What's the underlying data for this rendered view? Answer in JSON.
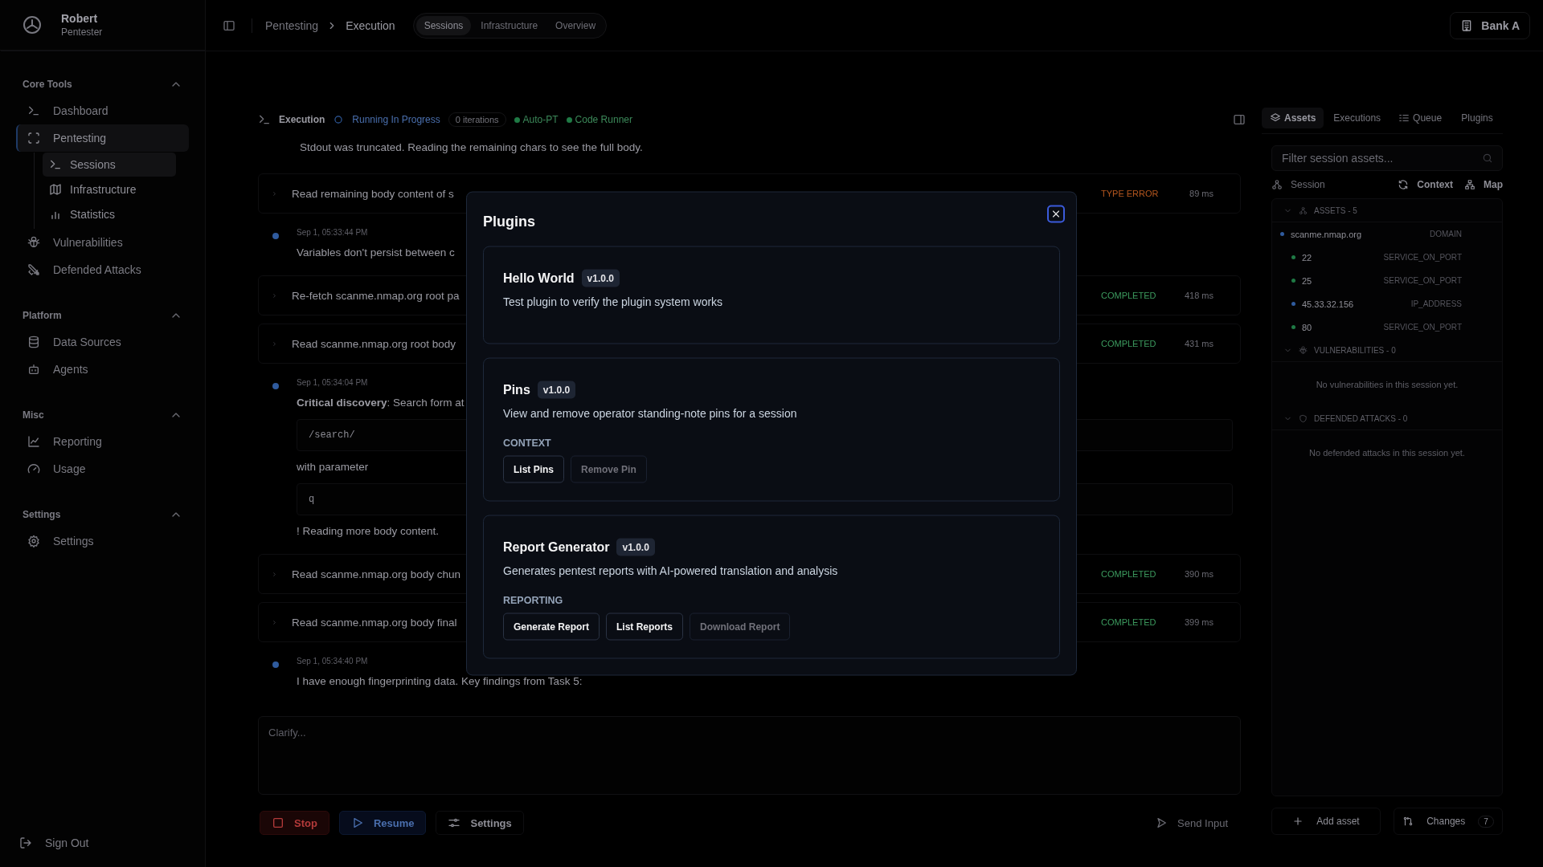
{
  "user": {
    "name": "Robert",
    "role": "Pentester"
  },
  "sidebar": {
    "sections": [
      {
        "title": "Core Tools",
        "expanded": true,
        "items": [
          {
            "label": "Dashboard",
            "selected": false
          },
          {
            "label": "Pentesting",
            "selected": true,
            "children": [
              {
                "label": "Sessions",
                "selected": true
              },
              {
                "label": "Infrastructure",
                "selected": false
              },
              {
                "label": "Statistics",
                "selected": false
              }
            ]
          },
          {
            "label": "Vulnerabilities",
            "selected": false
          },
          {
            "label": "Defended Attacks",
            "selected": false
          }
        ]
      },
      {
        "title": "Platform",
        "expanded": true,
        "items": [
          {
            "label": "Data Sources",
            "selected": false
          },
          {
            "label": "Agents",
            "selected": false
          }
        ]
      },
      {
        "title": "Misc",
        "expanded": true,
        "items": [
          {
            "label": "Reporting",
            "selected": false
          },
          {
            "label": "Usage",
            "selected": false
          }
        ]
      },
      {
        "title": "Settings",
        "expanded": true,
        "items": [
          {
            "label": "Settings",
            "selected": false
          }
        ]
      }
    ],
    "sign_out": "Sign Out"
  },
  "breadcrumb": [
    "Pentesting",
    "Execution"
  ],
  "view_tabs": [
    {
      "label": "Sessions",
      "selected": true
    },
    {
      "label": "Infrastructure",
      "selected": false
    },
    {
      "label": "Overview",
      "selected": false
    }
  ],
  "org_button": "Bank A",
  "execution": {
    "title": "Execution",
    "status": "Running In Progress",
    "iterations": "0 iterations",
    "badges": [
      "Auto-PT",
      "Code Runner"
    ],
    "log": [
      {
        "kind": "text",
        "text": "Stdout was truncated. Reading the remaining chars to see the full body."
      },
      {
        "kind": "tool",
        "text": "Read remaining body content of s",
        "status": {
          "text": "TYPE ERROR",
          "kind": "error"
        },
        "duration": "89 ms"
      },
      {
        "kind": "message",
        "time": "Sep 1, 05:33:44 PM",
        "parts": [
          {
            "kind": "text",
            "text": "Variables don't persist between c"
          }
        ]
      },
      {
        "kind": "tool",
        "text": "Re-fetch scanme.nmap.org root pa",
        "status": {
          "text": "COMPLETED",
          "kind": "ok"
        },
        "duration": "418 ms"
      },
      {
        "kind": "tool",
        "text": "Read scanme.nmap.org root body",
        "status": {
          "text": "COMPLETED",
          "kind": "ok"
        },
        "duration": "431 ms"
      },
      {
        "kind": "message",
        "time": "Sep 1, 05:34:04 PM",
        "parts": [
          {
            "kind": "text",
            "text": "**Critical discovery**: Search form at"
          },
          {
            "kind": "code",
            "text": "/search/"
          },
          {
            "kind": "text",
            "text": "with parameter"
          },
          {
            "kind": "code",
            "text": "q"
          },
          {
            "kind": "text",
            "text": "! Reading more body content."
          }
        ]
      },
      {
        "kind": "tool",
        "text": "Read scanme.nmap.org body chun",
        "status": {
          "text": "COMPLETED",
          "kind": "ok"
        },
        "duration": "390 ms"
      },
      {
        "kind": "tool",
        "text": "Read scanme.nmap.org body final",
        "status": {
          "text": "COMPLETED",
          "kind": "ok"
        },
        "duration": "399 ms"
      },
      {
        "kind": "message",
        "time": "Sep 1, 05:34:40 PM",
        "parts": [
          {
            "kind": "text",
            "text": "I have enough fingerprinting data. Key findings from Task 5:"
          }
        ]
      }
    ],
    "input_placeholder": "Clarify...",
    "buttons": [
      {
        "label": "Stop",
        "kind": "stop"
      },
      {
        "label": "Resume",
        "kind": "resume"
      },
      {
        "label": "Settings",
        "kind": "settings"
      }
    ],
    "send_button": "Send Input"
  },
  "right_panel": {
    "tabs": [
      {
        "label": "Assets",
        "selected": true
      },
      {
        "label": "Executions",
        "selected": false
      },
      {
        "label": "Queue",
        "selected": false
      },
      {
        "label": "Plugins",
        "selected": false
      }
    ],
    "filter_placeholder": "Filter session assets...",
    "toolbar": [
      "Session",
      "Context",
      "Map"
    ],
    "sections": [
      {
        "title": "ASSETS - 5",
        "expanded": true,
        "items": [
          {
            "name": "scanme.nmap.org",
            "type": "DOMAIN",
            "color": "#2f5b9e",
            "nested": false
          },
          {
            "name": "22",
            "type": "SERVICE_ON_PORT",
            "color": "#1f7a45",
            "nested": true
          },
          {
            "name": "25",
            "type": "SERVICE_ON_PORT",
            "color": "#1f7a45",
            "nested": true
          },
          {
            "name": "45.33.32.156",
            "type": "IP_ADDRESS",
            "color": "#2f5b9e",
            "nested": true
          },
          {
            "name": "80",
            "type": "SERVICE_ON_PORT",
            "color": "#1f7a45",
            "nested": true
          }
        ]
      },
      {
        "title": "VULNERABILITIES - 0",
        "expanded": true,
        "empty": "No vulnerabilities in this session yet."
      },
      {
        "title": "DEFENDED ATTACKS - 0",
        "expanded": true,
        "empty": "No defended attacks in this session yet."
      }
    ],
    "add_button": "Add asset",
    "changes_button": "Changes",
    "changes_count": "7"
  },
  "modal": {
    "title": "Plugins",
    "plugins": [
      {
        "name": "Hello World",
        "version": "v1.0.0",
        "description": "Test plugin to verify the plugin system works"
      },
      {
        "name": "Pins",
        "version": "v1.0.0",
        "description": "View and remove operator standing-note pins for a session",
        "category": "CONTEXT",
        "actions": [
          {
            "label": "List Pins",
            "disabled": false
          },
          {
            "label": "Remove Pin",
            "disabled": true
          }
        ]
      },
      {
        "name": "Report Generator",
        "version": "v1.0.0",
        "description": "Generates pentest reports with AI-powered translation and analysis",
        "category": "REPORTING",
        "actions": [
          {
            "label": "Generate Report",
            "disabled": false
          },
          {
            "label": "List Reports",
            "disabled": false
          },
          {
            "label": "Download Report",
            "disabled": true
          }
        ]
      }
    ]
  }
}
